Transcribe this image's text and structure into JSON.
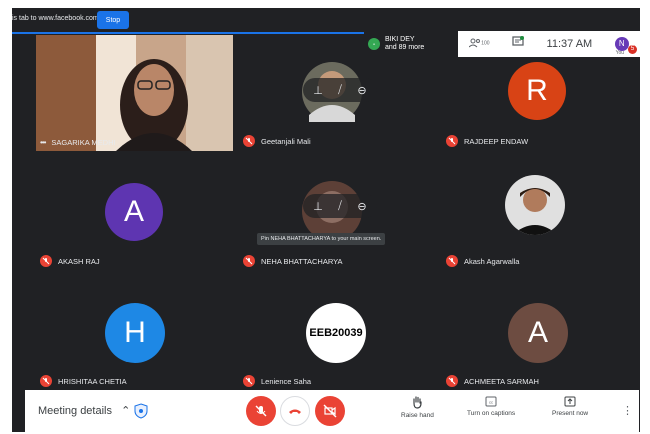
{
  "share_bar": {
    "message": "is tab to www.facebook.com",
    "stop_label": "Stop"
  },
  "presenter": {
    "name": "BIKI DEY",
    "more": "and 89 more"
  },
  "header": {
    "people_count": "100",
    "clock": "11:37 AM",
    "you_initial": "N",
    "you_label": "You",
    "notification_count": "5"
  },
  "participants": [
    {
      "name": "SAGARIKA MEDHI",
      "type": "video"
    },
    {
      "name": "Geetanjali Mali",
      "type": "video"
    },
    {
      "name": "RAJDEEP ENDAW",
      "type": "avatar",
      "initial": "R",
      "color": "#d84315"
    },
    {
      "name": "AKASH RAJ",
      "type": "avatar",
      "initial": "A",
      "color": "#5e35b1"
    },
    {
      "name": "NEHA BHATTACHARYA",
      "type": "video"
    },
    {
      "name": "Akash Agarwalla",
      "type": "video"
    },
    {
      "name": "HRISHITAA CHETIA",
      "type": "avatar",
      "initial": "H",
      "color": "#1e88e5"
    },
    {
      "name": "Lenience Saha",
      "type": "image",
      "image_text": "EEB20039"
    },
    {
      "name": "ACHMEETA SARMAH",
      "type": "avatar",
      "initial": "A",
      "color": "#6d4c41"
    }
  ],
  "tooltip": "Pin NEHA BHATTACHARYA to your main screen.",
  "bottom": {
    "meeting_details": "Meeting details",
    "raise_hand": "Raise hand",
    "captions": "Turn on captions",
    "present": "Present now"
  },
  "colors": {
    "danger": "#ea4335",
    "accent": "#1a73e8",
    "tile": "#3c4043"
  }
}
